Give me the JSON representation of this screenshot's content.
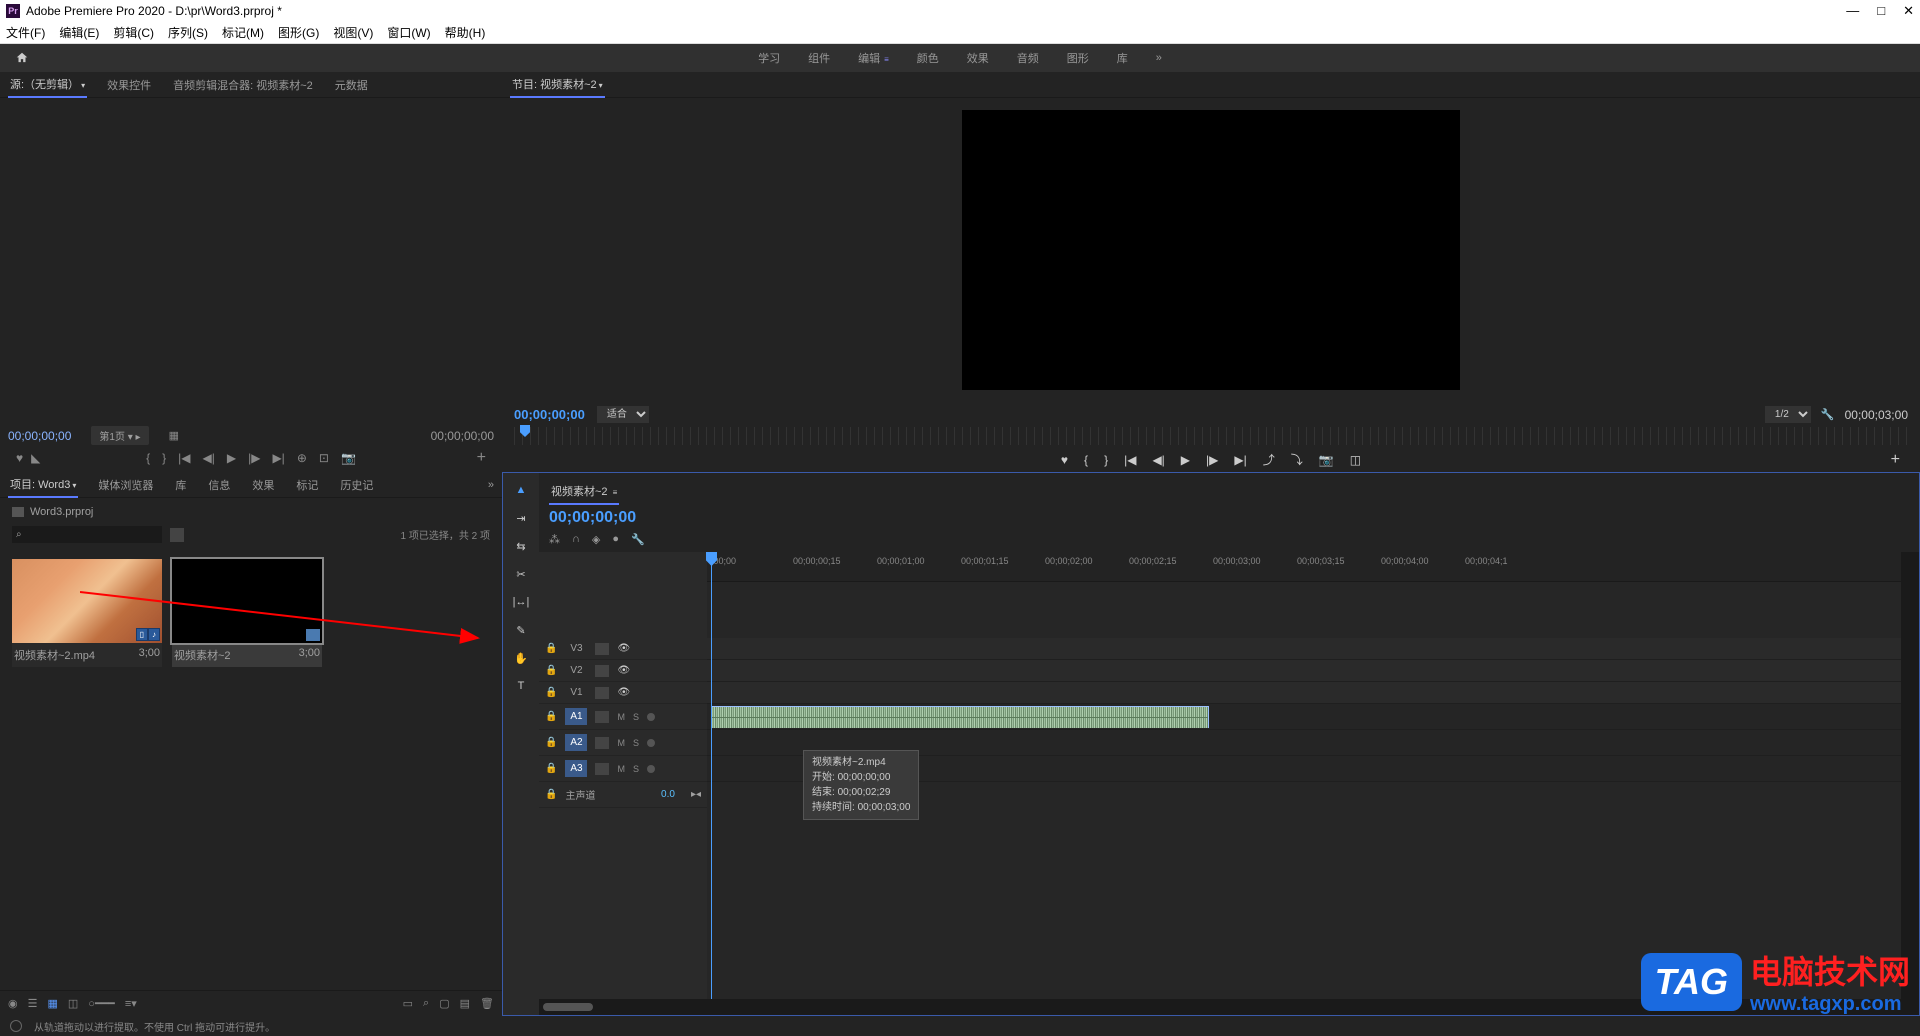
{
  "title_bar": {
    "app_icon": "Pr",
    "title": "Adobe Premiere Pro 2020 - D:\\pr\\Word3.prproj *"
  },
  "menu": [
    "文件(F)",
    "编辑(E)",
    "剪辑(C)",
    "序列(S)",
    "标记(M)",
    "图形(G)",
    "视图(V)",
    "窗口(W)",
    "帮助(H)"
  ],
  "workspaces": {
    "items": [
      "学习",
      "组件",
      "编辑",
      "颜色",
      "效果",
      "音频",
      "图形",
      "库"
    ],
    "active_index": 2,
    "more": "»"
  },
  "source_panel": {
    "tabs": [
      "源:（无剪辑）",
      "效果控件",
      "音频剪辑混合器: 视频素材~2",
      "元数据"
    ],
    "active_tab": 0,
    "tc_left": "00;00;00;00",
    "pager": "第1页",
    "tc_right": "00;00;00;00"
  },
  "program_panel": {
    "tab": "节目: 视频素材~2",
    "tc_left": "00;00;00;00",
    "fit": "适合",
    "quality": "1/2",
    "tc_right": "00;00;03;00"
  },
  "project_panel": {
    "tabs": [
      "项目: Word3",
      "媒体浏览器",
      "库",
      "信息",
      "效果",
      "标记",
      "历史记"
    ],
    "active_tab": 0,
    "breadcrumb": "Word3.prproj",
    "search_placeholder": "",
    "status": "1 项已选择，共 2 项",
    "items": [
      {
        "name": "视频素材~2.mp4",
        "dur": "3;00",
        "type": "clip"
      },
      {
        "name": "视频素材~2",
        "dur": "3;00",
        "type": "sequence"
      }
    ]
  },
  "timeline": {
    "seq_name": "视频素材~2",
    "tc": "00;00;00;00",
    "ruler": [
      ";00;00",
      "00;00;00;15",
      "00;00;01;00",
      "00;00;01;15",
      "00;00;02;00",
      "00;00;02;15",
      "00;00;03;00",
      "00;00;03;15",
      "00;00;04;00",
      "00;00;04;1"
    ],
    "video_tracks": [
      "V3",
      "V2",
      "V1"
    ],
    "audio_tracks": [
      "A1",
      "A2",
      "A3"
    ],
    "master": "主声道",
    "master_vol": "0.0",
    "track_mute": "M",
    "track_solo": "S",
    "tooltip": {
      "name": "视频素材~2.mp4",
      "start_label": "开始:",
      "start": "00;00;00;00",
      "end_label": "结束:",
      "end": "00;00;02;29",
      "dur_label": "持续时间:",
      "dur": "00;00;03;00"
    }
  },
  "watermark": {
    "tag": "TAG",
    "cn": "电脑技术网",
    "url": "www.tagxp.com"
  },
  "status_bar": {
    "text": "从轨道拖动以进行提取。不使用 Ctrl 拖动可进行提升。"
  }
}
